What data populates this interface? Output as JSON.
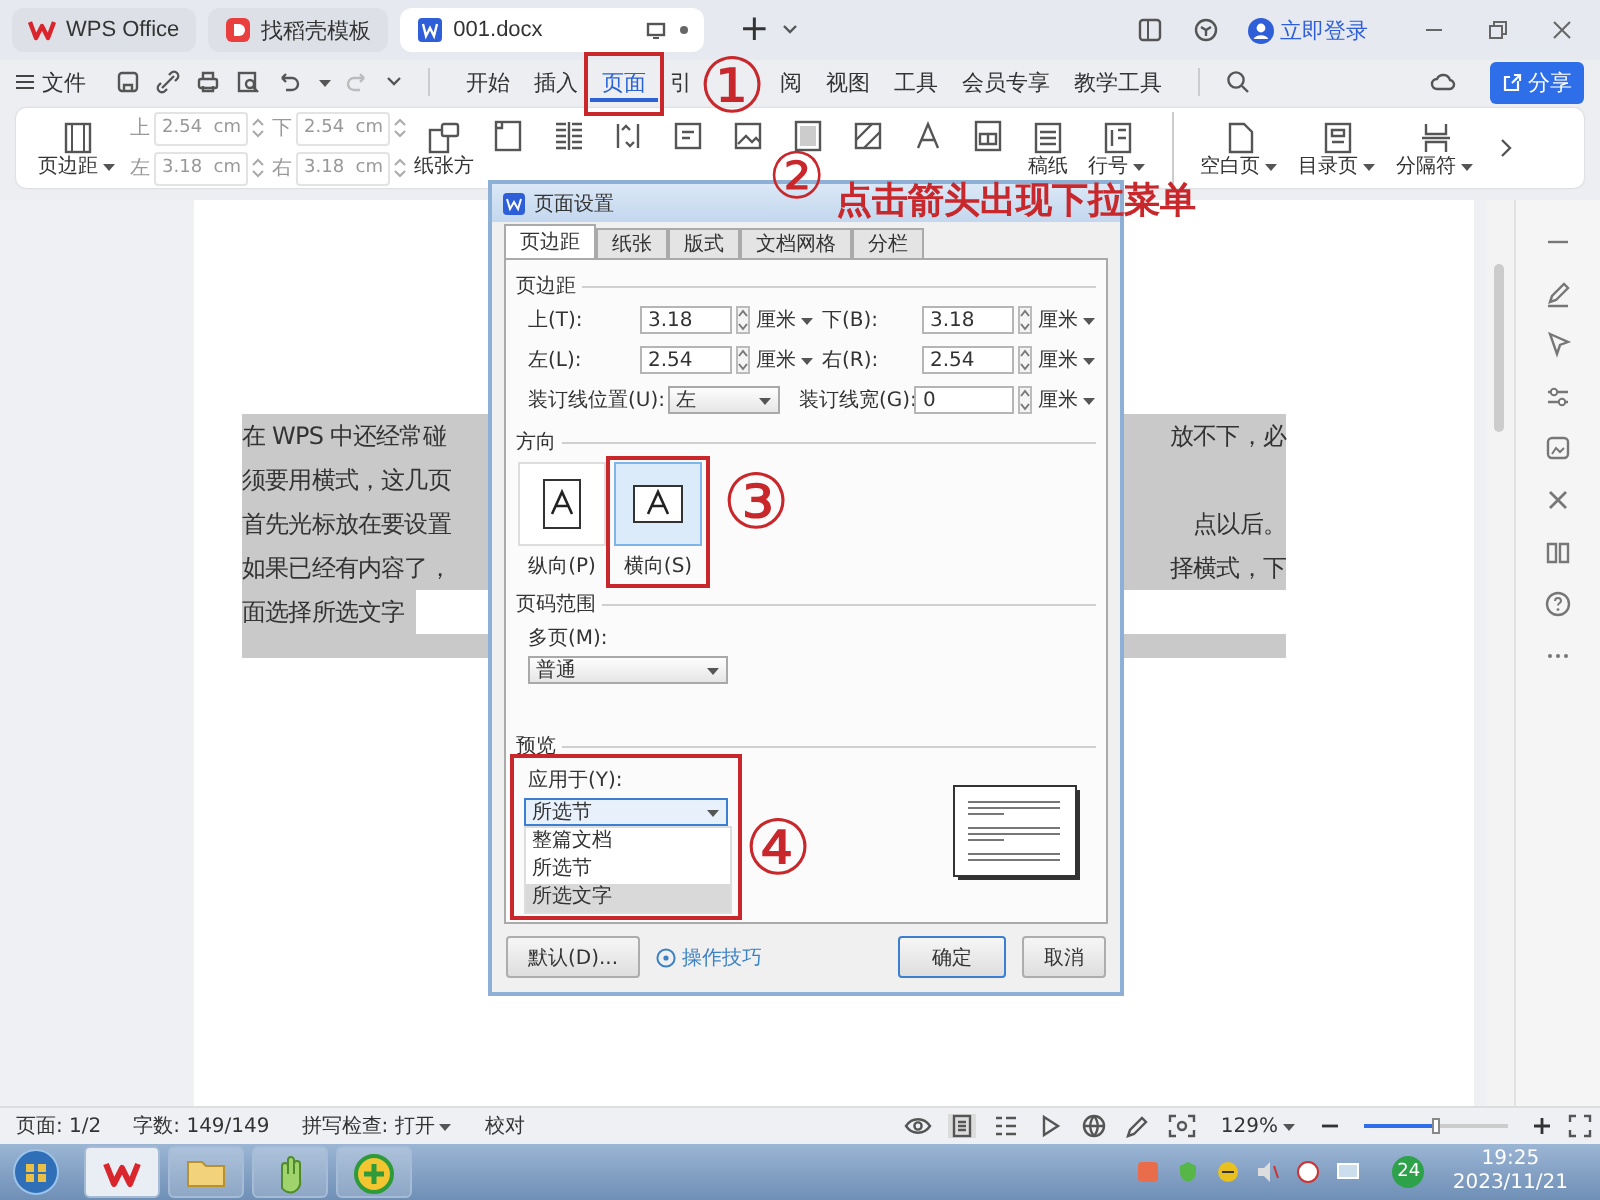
{
  "window": {
    "tabs": [
      {
        "label": "WPS Office",
        "kind": "home",
        "selected": false
      },
      {
        "label": "找稻壳模板",
        "kind": "template",
        "selected": false
      },
      {
        "label": "001.docx",
        "kind": "doc",
        "selected": true
      }
    ],
    "new_tab": "+",
    "account": "立即登录"
  },
  "menu": {
    "file": "文件",
    "tabs": [
      {
        "label": "开始",
        "selected": false
      },
      {
        "label": "插入",
        "selected": false
      },
      {
        "label": "页面",
        "selected": true
      },
      {
        "label": "引",
        "selected": false
      },
      {
        "label": "阅",
        "selected": false
      },
      {
        "label": "视图",
        "selected": false
      },
      {
        "label": "工具",
        "selected": false
      },
      {
        "label": "会员专享",
        "selected": false
      },
      {
        "label": "教学工具",
        "selected": false
      }
    ],
    "share": "分享"
  },
  "ribbon": {
    "margins_button": "页边距",
    "fields": [
      {
        "label": "上",
        "value": "2.54",
        "unit": "cm",
        "disabled": true
      },
      {
        "label": "下",
        "value": "2.54",
        "unit": "cm",
        "disabled": true
      },
      {
        "label": "左",
        "value": "3.18",
        "unit": "cm",
        "disabled": true
      },
      {
        "label": "右",
        "value": "3.18",
        "unit": "cm",
        "disabled": true
      }
    ],
    "orientation_button": "纸张方",
    "tools": [
      {
        "label": "稿纸",
        "dropdown": false
      },
      {
        "label": "行号",
        "dropdown": true
      }
    ],
    "page_tools": [
      {
        "label": "空白页",
        "dropdown": true
      },
      {
        "label": "目录页",
        "dropdown": true
      },
      {
        "label": "分隔符",
        "dropdown": true
      }
    ]
  },
  "document": {
    "lines": [
      {
        "left": "在 WPS 中还经常碰",
        "right": "放不下，必"
      },
      {
        "left": "须要用横式，这几页"
      },
      {
        "left": "首先光标放在要设置",
        "right": "点以后。"
      },
      {
        "left": "如果已经有内容了，",
        "right": "择横式，下"
      },
      {
        "left": "面选择所选文字"
      }
    ]
  },
  "dialog": {
    "title": "页面设置",
    "tabs": [
      {
        "label": "页边距",
        "selected": true
      },
      {
        "label": "纸张",
        "selected": false
      },
      {
        "label": "版式",
        "selected": false
      },
      {
        "label": "文档网格",
        "selected": false
      },
      {
        "label": "分栏",
        "selected": false
      }
    ],
    "margins": {
      "heading": "页边距",
      "fields": [
        {
          "label": "上(T):",
          "value": "3.18",
          "unit": "厘米"
        },
        {
          "label": "下(B):",
          "value": "3.18",
          "unit": "厘米"
        },
        {
          "label": "左(L):",
          "value": "2.54",
          "unit": "厘米"
        },
        {
          "label": "右(R):",
          "value": "2.54",
          "unit": "厘米"
        }
      ],
      "gutter_position": {
        "label": "装订线位置(U):",
        "value": "左"
      },
      "gutter_width": {
        "label": "装订线宽(G):",
        "value": "0",
        "unit": "厘米"
      }
    },
    "orientation": {
      "heading": "方向",
      "options": [
        {
          "label": "纵向(P)",
          "kind": "portrait",
          "selected": false
        },
        {
          "label": "横向(S)",
          "kind": "landscape",
          "selected": true
        }
      ]
    },
    "page_range": {
      "heading": "页码范围",
      "label": "多页(M):",
      "value": "普通"
    },
    "preview": {
      "heading": "预览",
      "apply_label": "应用于(Y):",
      "apply_value": "所选节",
      "options": [
        {
          "label": "整篇文档",
          "selected": false
        },
        {
          "label": "所选节",
          "selected": false
        },
        {
          "label": "所选文字",
          "selected": true
        }
      ]
    },
    "buttons": {
      "default": "默认(D)...",
      "tips": "操作技巧",
      "ok": "确定",
      "cancel": "取消"
    }
  },
  "annotations": [
    {
      "number": "①",
      "boxed": true
    },
    {
      "number": "②",
      "text": "点击箭头出现下拉菜单",
      "boxed": false
    },
    {
      "number": "③",
      "boxed": true
    },
    {
      "number": "④",
      "boxed": true
    }
  ],
  "status_bar": {
    "page": "页面: 1/2",
    "words": "字数: 149/149",
    "spell": "拼写检查: 打开",
    "proof": "校对",
    "zoom": "129%",
    "zoom_slider": {
      "level": 0.5
    }
  },
  "taskbar": {
    "badge": "24",
    "time": "19:25",
    "date": "2023/11/21"
  }
}
